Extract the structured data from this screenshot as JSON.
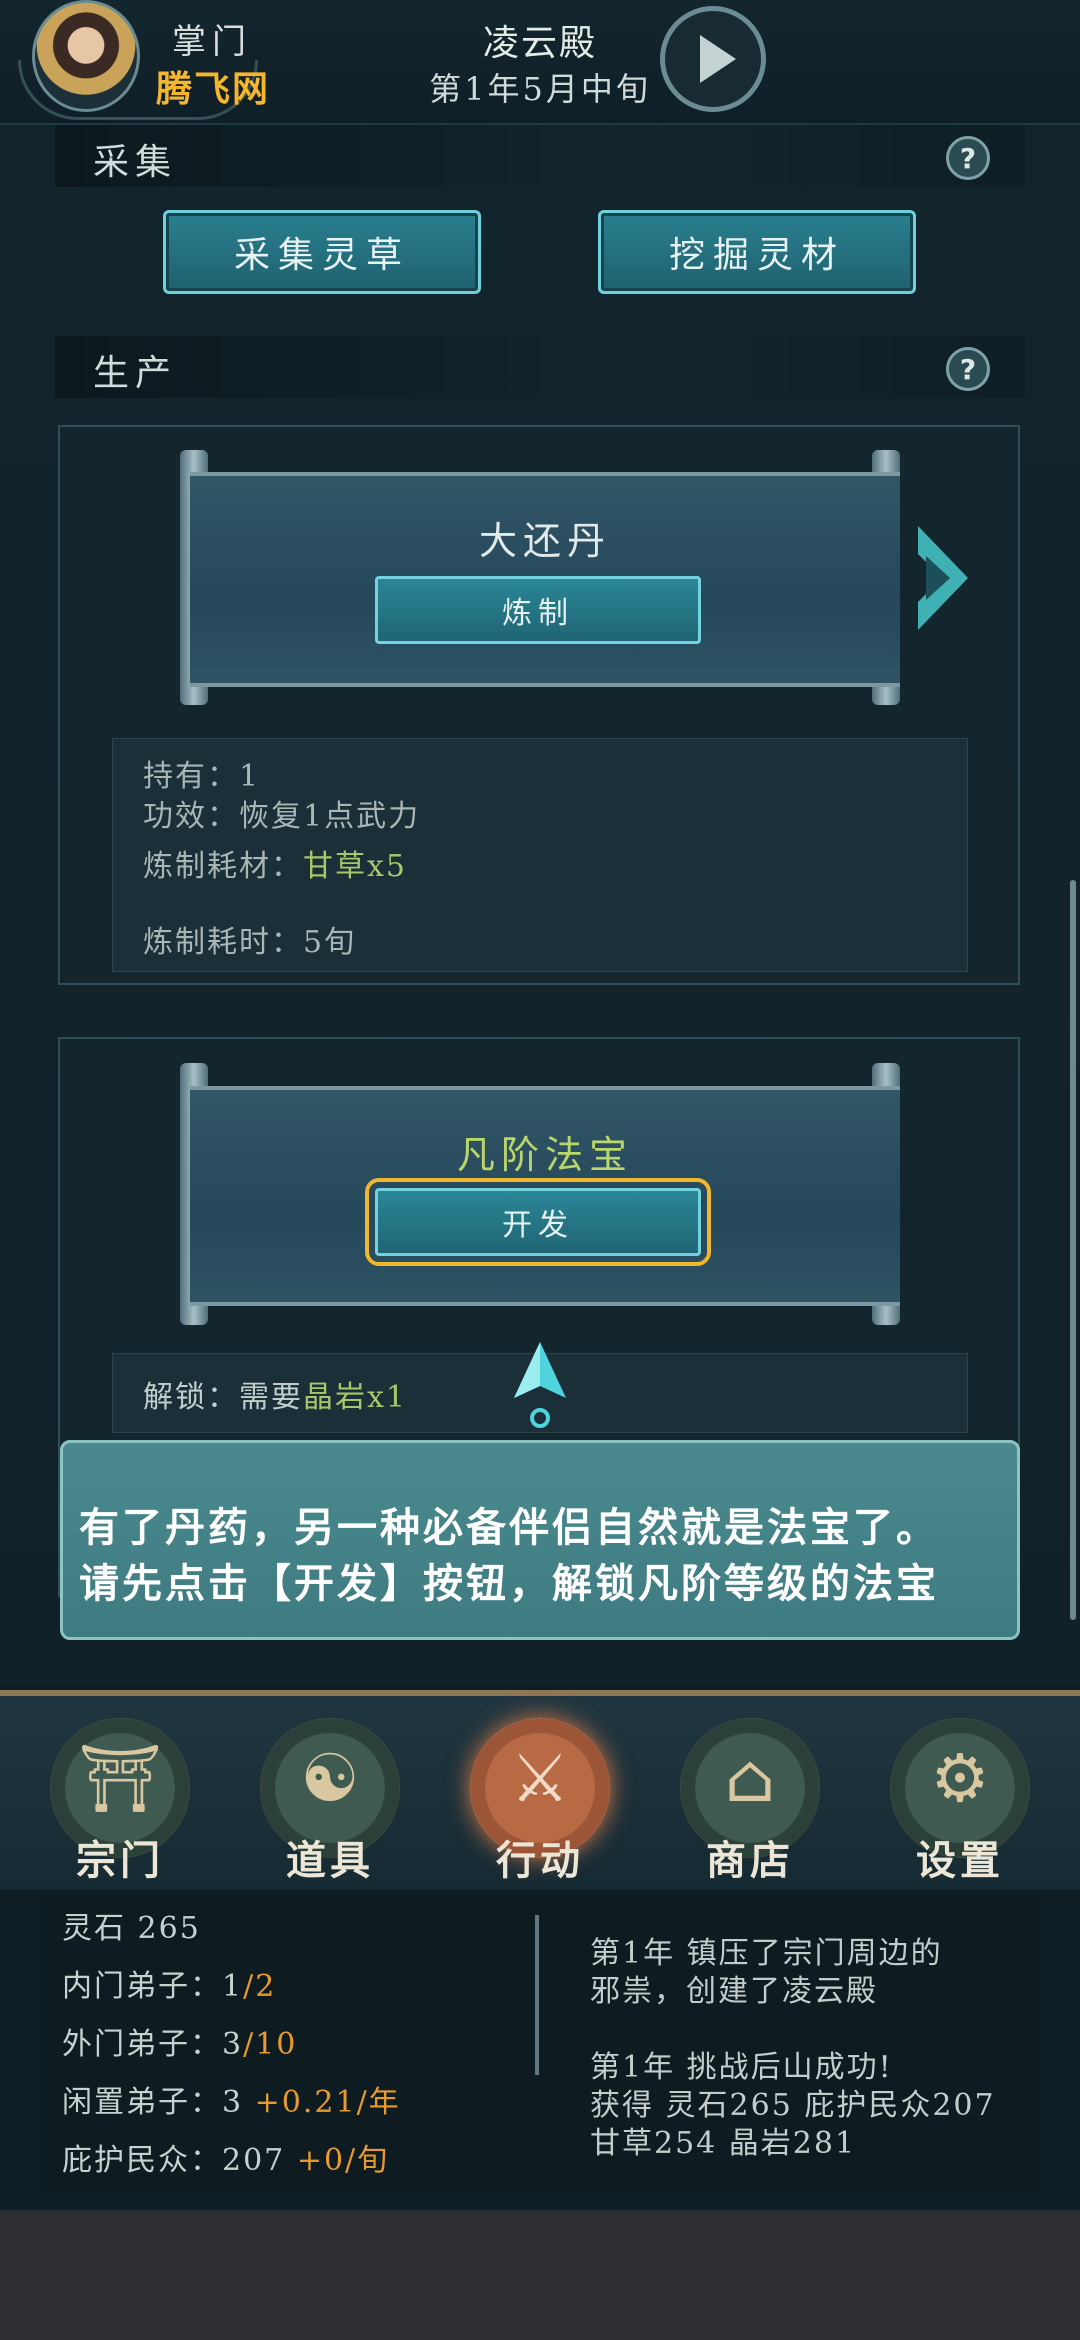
{
  "header": {
    "role": "掌门",
    "site": "腾飞网",
    "sect_name": "凌云殿",
    "date": "第1年5月中旬"
  },
  "gather": {
    "title": "采集",
    "help": "?",
    "buttons": [
      "采集灵草",
      "挖掘灵材"
    ]
  },
  "production": {
    "title": "生产",
    "help": "?",
    "recipe1": {
      "name": "大还丹",
      "button": "炼制",
      "held": "持有：1",
      "effect": "功效：恢复1点武力",
      "material_label": "炼制耗材：",
      "material_value": "甘草x5",
      "time": "炼制耗时：5旬"
    },
    "recipe2": {
      "name": "凡阶法宝",
      "button": "开发",
      "unlock_label": "解锁：需要",
      "unlock_item": "晶岩",
      "unlock_count": "x1"
    }
  },
  "tutorial": {
    "line1": "有了丹药，另一种必备伴侣自然就是法宝了。",
    "line2": "请先点击【开发】按钮，解锁凡阶等级的法宝"
  },
  "nav": [
    {
      "label": "宗门",
      "glyph": "⛩"
    },
    {
      "label": "道具",
      "glyph": "☯"
    },
    {
      "label": "行动",
      "glyph": "⚔"
    },
    {
      "label": "商店",
      "glyph": "⌂"
    },
    {
      "label": "设置",
      "glyph": "⚙"
    }
  ],
  "stats": {
    "spirit_stone": "灵石 265",
    "inner_label": "内门弟子：",
    "inner_count": "1",
    "inner_max": "/2",
    "outer_label": "外门弟子：",
    "outer_count": "3",
    "outer_max": "/10",
    "idle_label": "闲置弟子：",
    "idle_count": "3",
    "idle_rate": "+0.21/年",
    "people_label": "庇护民众：",
    "people_count": "207",
    "people_rate": "+0/旬"
  },
  "log": {
    "line1": "第1年 镇压了宗门周边的",
    "line2": "邪祟，创建了凌云殿",
    "line3": "第1年 挑战后山成功!",
    "line4": "获得 灵石265 庇护民众207",
    "line5": "甘草254 晶岩281"
  },
  "colors": {
    "accent_cyan": "#6fd0dc",
    "highlight_gold": "#f5b52c",
    "green_text": "#a6c86a",
    "orange_text": "#e89a2c"
  }
}
